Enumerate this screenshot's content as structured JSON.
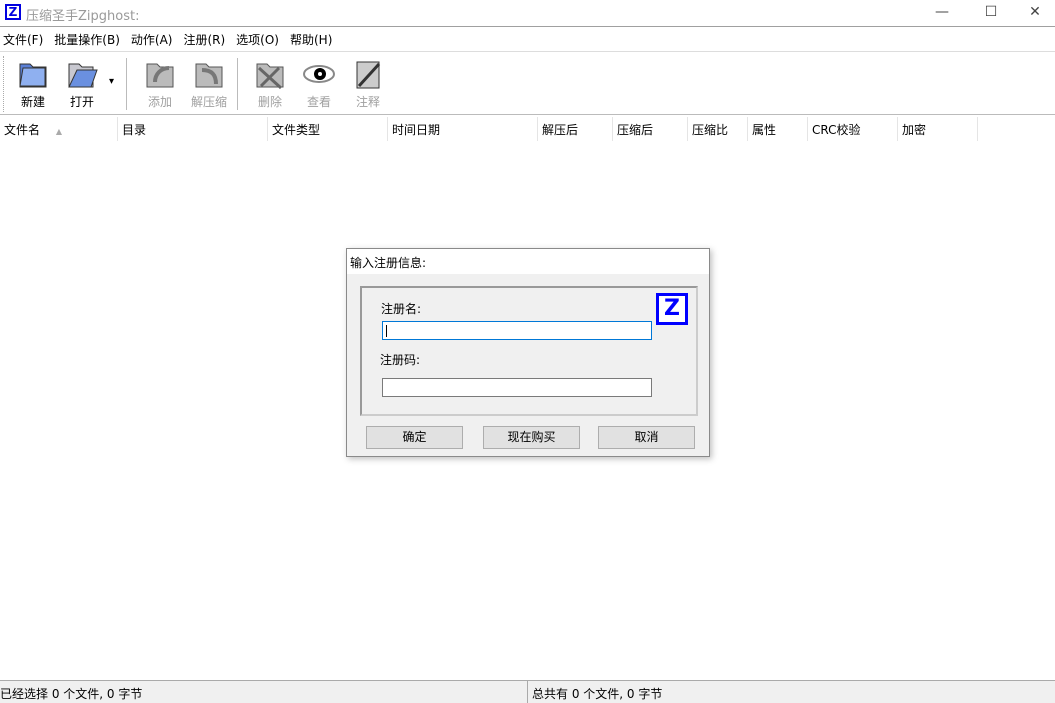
{
  "window": {
    "title": "压缩圣手Zipghost:",
    "logo_letter": "Z",
    "minimize": "—",
    "maximize": "☐",
    "close": "✕"
  },
  "menu": [
    "文件(F)",
    "批量操作(B)",
    "动作(A)",
    "注册(R)",
    "选项(O)",
    "帮助(H)"
  ],
  "toolbar": {
    "new": "新建",
    "open": "打开",
    "add": "添加",
    "extract": "解压缩",
    "delete": "删除",
    "view": "查看",
    "comment": "注释",
    "dropdown": "▾"
  },
  "columns": [
    "文件名",
    "目录",
    "文件类型",
    "时间日期",
    "解压后",
    "压缩后",
    "压缩比",
    "属性",
    "CRC校验",
    "加密"
  ],
  "sort_indicator": "▲",
  "status": {
    "selected": "已经选择 0 个文件, 0 字节",
    "total": "总共有 0 个文件, 0 字节"
  },
  "dialog": {
    "title": "输入注册信息:",
    "name_label": "注册名:",
    "name_value": "",
    "code_label": "注册码:",
    "code_value": "",
    "logo_letter": "Z",
    "ok": "确定",
    "buy": "现在购买",
    "cancel": "取消"
  }
}
